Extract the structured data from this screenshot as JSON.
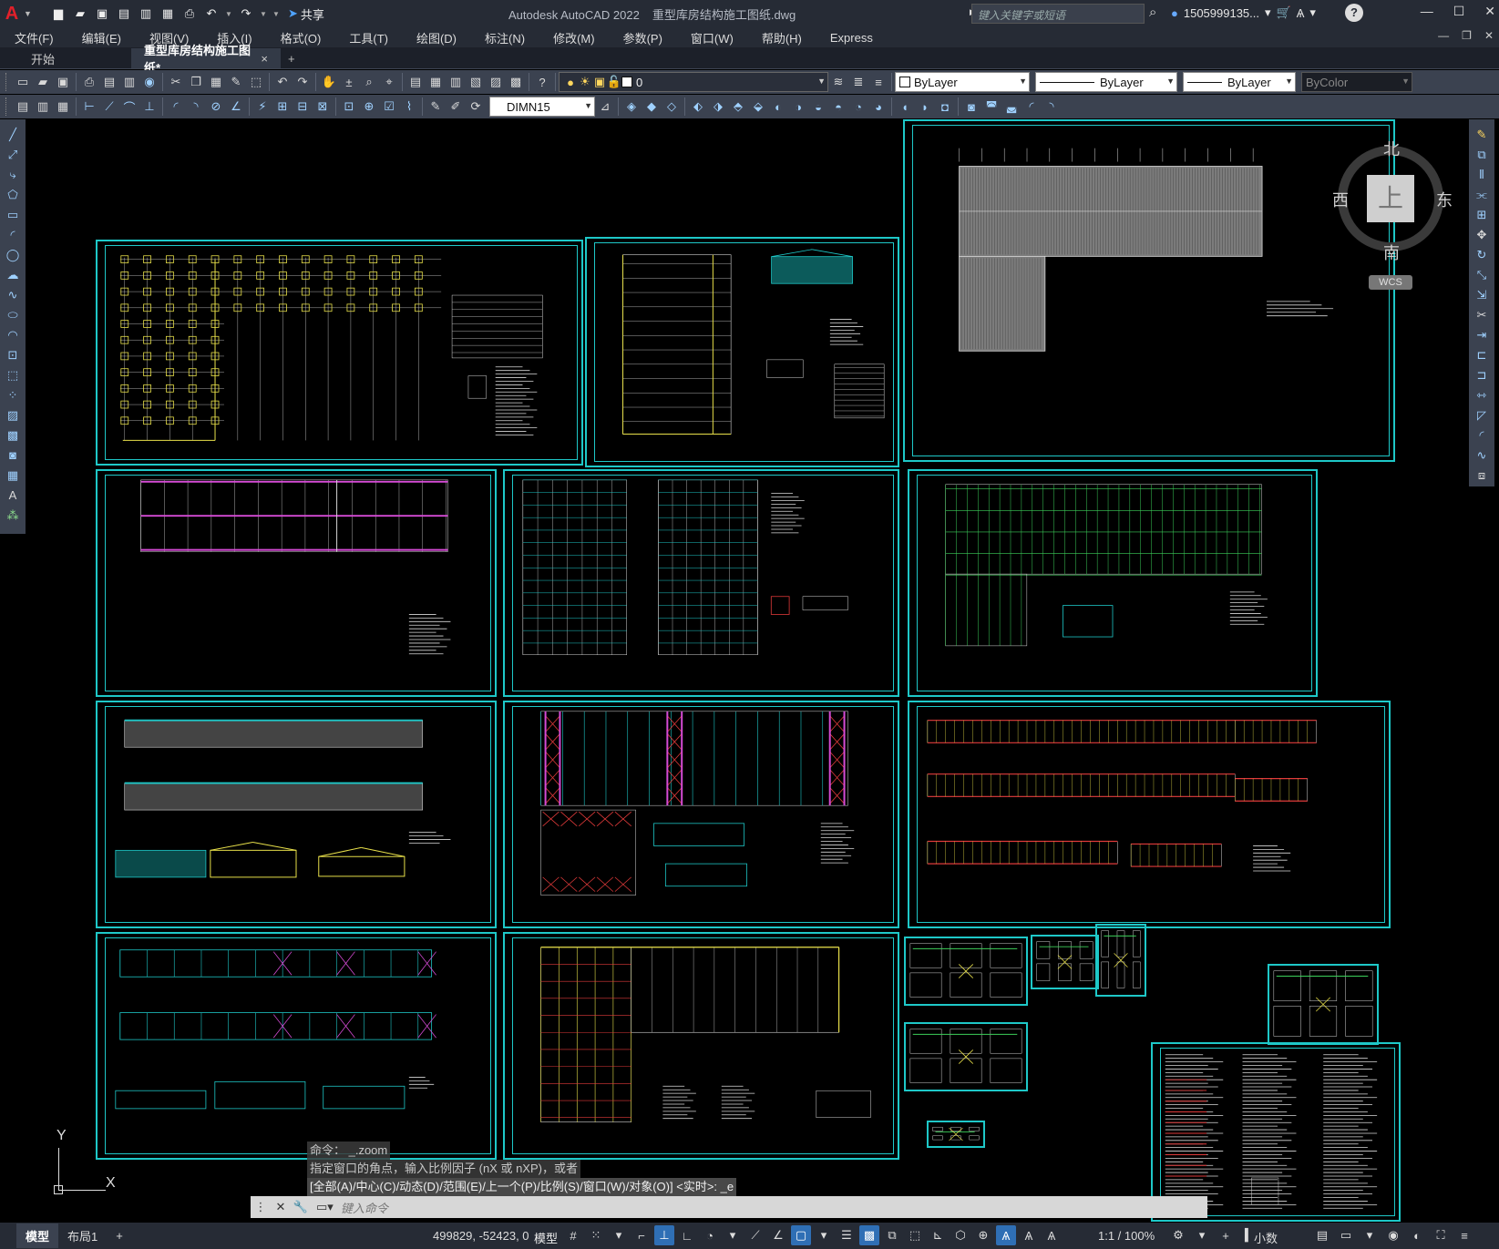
{
  "app": {
    "logo": "A",
    "title": "Autodesk AutoCAD 2022",
    "filename": "重型库房结构施工图纸.dwg",
    "share_label": "共享",
    "search_placeholder": "键入关键字或短语",
    "username": "1505999135...",
    "help": "?"
  },
  "menu": [
    "文件(F)",
    "编辑(E)",
    "视图(V)",
    "插入(I)",
    "格式(O)",
    "工具(T)",
    "绘图(D)",
    "标注(N)",
    "修改(M)",
    "参数(P)",
    "窗口(W)",
    "帮助(H)",
    "Express"
  ],
  "tabs": {
    "start": "开始",
    "active": "重型库房结构施工图纸*",
    "close": "×",
    "add": "+"
  },
  "toolbar": {
    "layer": "0",
    "color": "ByLayer",
    "linetype": "ByLayer",
    "lineweight": "ByLayer",
    "plotstyle": "ByColor",
    "dimstyle": "DIMN15"
  },
  "viewcube": {
    "north": "北",
    "south": "南",
    "east": "东",
    "west": "西",
    "top": "上",
    "wcs": "WCS"
  },
  "ucs": {
    "x": "X",
    "y": "Y"
  },
  "command": {
    "history": [
      "命令：  _.zoom",
      "指定窗口的角点，输入比例因子 (nX 或 nXP)，或者",
      "[全部(A)/中心(C)/动态(D)/范围(E)/上一个(P)/比例(S)/窗口(W)/对象(O)] <实时>: _e"
    ],
    "placeholder": "键入命令"
  },
  "status": {
    "model_tab": "模型",
    "layout_tab": "布局1",
    "add_tab": "+",
    "coords": "499829, -52423, 0",
    "space": "模型",
    "scale": "1:1 / 100%",
    "units": "小数"
  },
  "colors": {
    "frame": "#1ec8c8",
    "title_bar": "#262b35",
    "toolbar": "#3b4250",
    "canvas": "#000000"
  }
}
